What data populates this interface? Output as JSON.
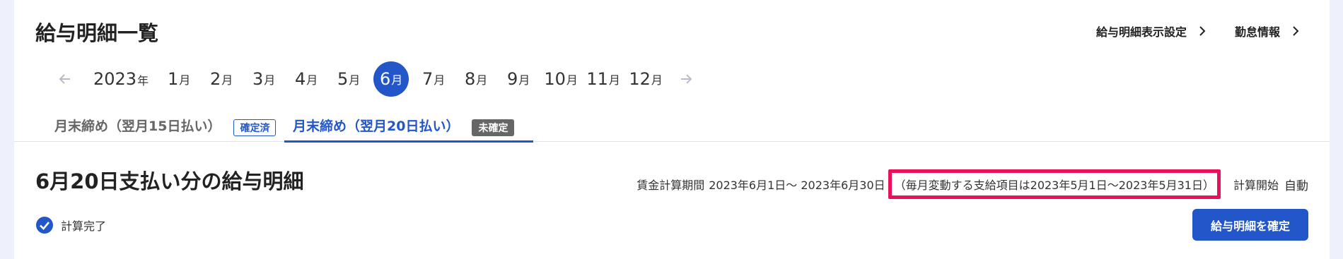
{
  "header": {
    "title": "給与明細一覧",
    "links": [
      {
        "label": "給与明細表示設定",
        "icon": "chevron-right-icon"
      },
      {
        "label": "勤怠情報",
        "icon": "chevron-right-icon"
      }
    ]
  },
  "month_nav": {
    "prev_icon": "arrow-left-icon",
    "next_icon": "arrow-right-icon",
    "year": "2023",
    "year_unit": "年",
    "month_unit": "月",
    "months": [
      "1",
      "2",
      "3",
      "4",
      "5",
      "6",
      "7",
      "8",
      "9",
      "10",
      "11",
      "12"
    ],
    "selected_month": "6"
  },
  "tabs": [
    {
      "label": "月末締め（翌月15日払い）",
      "badge": "確定済",
      "active": false
    },
    {
      "label": "月末締め（翌月20日払い）",
      "badge": "未確定",
      "active": true
    }
  ],
  "payslip": {
    "title": "6月20日支払い分の給与明細",
    "period_label": "賃金計算期間",
    "period_range": "2023年6月1日～ 2023年6月30日",
    "period_note": "（毎月変動する支給項目は2023年5月1日～2023年5月31日）",
    "calc_label": "計算開始",
    "calc_value": "自動",
    "status_text": "計算完了",
    "status_icon": "check-circle-icon",
    "confirm_button": "給与明細を確定"
  },
  "colors": {
    "accent": "#2357c9",
    "highlight_border": "#e8115a",
    "badge_gray": "#666666",
    "background": "#eef0fb"
  }
}
